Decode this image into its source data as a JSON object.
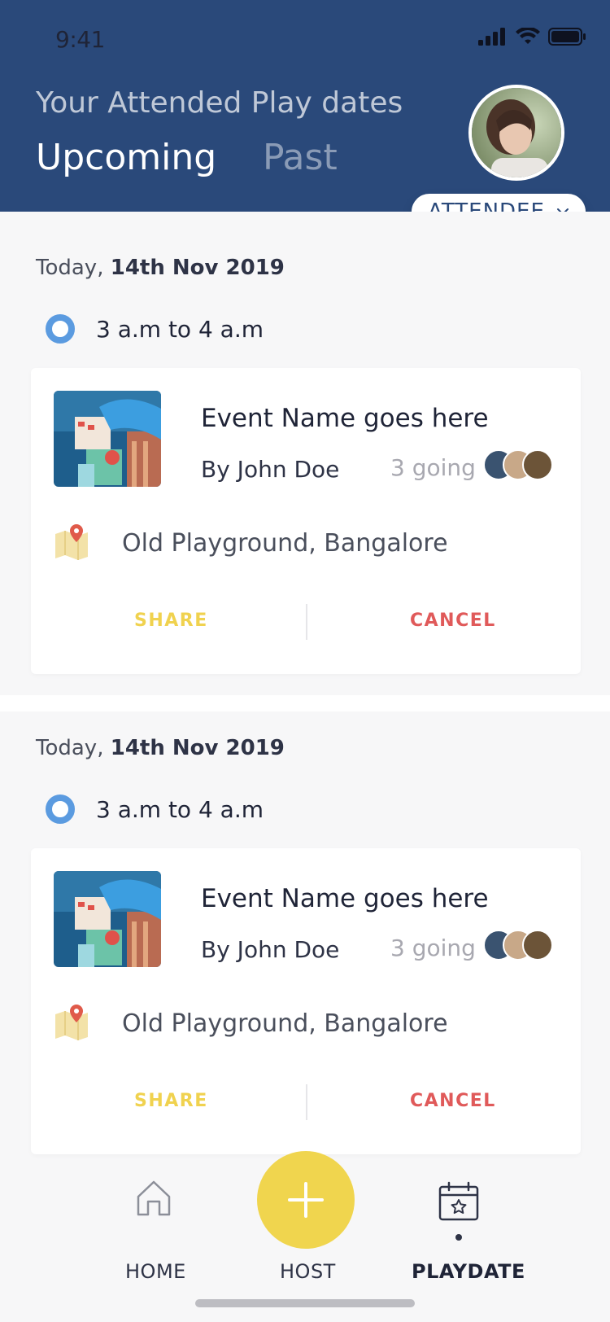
{
  "status_bar": {
    "time": "9:41"
  },
  "header": {
    "title": "Your Attended Play dates",
    "tabs": [
      {
        "label": "Upcoming",
        "active": true
      },
      {
        "label": "Past",
        "active": false
      }
    ],
    "role_selector": "ATTENDEE"
  },
  "events": [
    {
      "date_prefix": "Today,",
      "date": "14th Nov 2019",
      "time": "3 a.m to 4 a.m",
      "name": "Event Name goes here",
      "host": "By John Doe",
      "going": "3 going",
      "location": "Old Playground, Bangalore",
      "share_label": "SHARE",
      "cancel_label": "CANCEL"
    },
    {
      "date_prefix": "Today,",
      "date": "14th Nov 2019",
      "time": "3 a.m to 4 a.m",
      "name": "Event Name goes here",
      "host": "By John Doe",
      "going": "3 going",
      "location": "Old Playground, Bangalore",
      "share_label": "SHARE",
      "cancel_label": "CANCEL"
    }
  ],
  "bottom_nav": {
    "items": [
      {
        "label": "HOME",
        "icon": "home-icon",
        "active": false
      },
      {
        "label": "HOST",
        "icon": "plus-icon",
        "active": false
      },
      {
        "label": "PLAYDATE",
        "icon": "calendar-star-icon",
        "active": true
      }
    ]
  },
  "colors": {
    "header_bg": "#2A497A",
    "accent_yellow": "#F0D54E",
    "cancel_red": "#E05A5A",
    "radio_blue": "#5B9BE0"
  }
}
